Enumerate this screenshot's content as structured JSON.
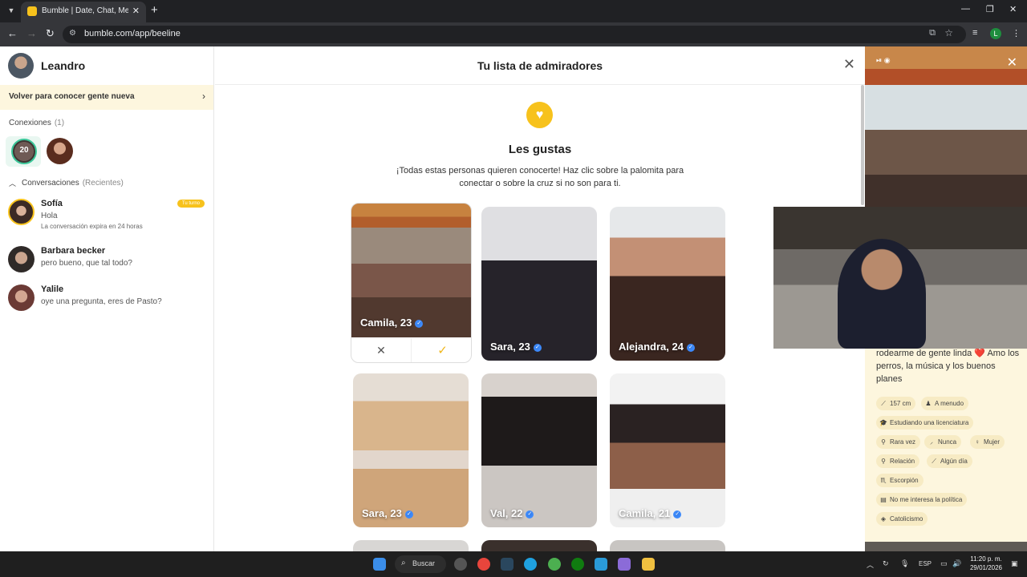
{
  "browser": {
    "tab_title": "Bumble | Date, Chat, Meet New",
    "url": "bumble.com/app/beeline",
    "profile_initial": "L"
  },
  "sidebar": {
    "user_name": "Leandro",
    "back_label": "Volver para conocer gente nueva",
    "connections_label": "Conexiones",
    "connections_count": "(1)",
    "connection_badge": "20",
    "conversations_label": "Conversaciones",
    "conversations_sub": "(Recientes)",
    "conversations": [
      {
        "name": "Sofía",
        "message": "Hola",
        "sub": "La conversación expira en 24 horas",
        "badge": "Tu turno"
      },
      {
        "name": "Barbara becker",
        "message": "pero bueno, que tal todo?"
      },
      {
        "name": "Yalile",
        "message": "oye una pregunta, eres de Pasto?"
      }
    ]
  },
  "main": {
    "title": "Tu lista de admiradores",
    "likes_title": "Les gustas",
    "likes_desc": "¡Todas estas personas quieren conocerte! Haz clic sobre la palomita para conectar o sobre la cruz si no son para ti.",
    "cards": [
      {
        "label": "Camila, 23"
      },
      {
        "label": "Sara, 23"
      },
      {
        "label": "Alejandra, 24"
      },
      {
        "label": "Sara, 23"
      },
      {
        "label": "Val, 22"
      },
      {
        "label": "Camila, 21"
      }
    ]
  },
  "profile_panel": {
    "bio": "rodearme de gente linda ❤️ Amo los perros, la música y los buenos planes",
    "chips": [
      "157 cm",
      "A menudo",
      "Estudiando una licenciatura",
      "Rara vez",
      "Nunca",
      "Mujer",
      "Relación",
      "Algún día",
      "Escorpión",
      "No me interesa la política",
      "Catolicismo"
    ]
  },
  "taskbar": {
    "search_label": "Buscar",
    "lang": "ESP",
    "time": "11:20 p. m.",
    "date": "29/01/2026"
  },
  "colors": {
    "accent": "#f7c21c",
    "banner": "#fdf6de",
    "verify": "#3d8bfd"
  }
}
